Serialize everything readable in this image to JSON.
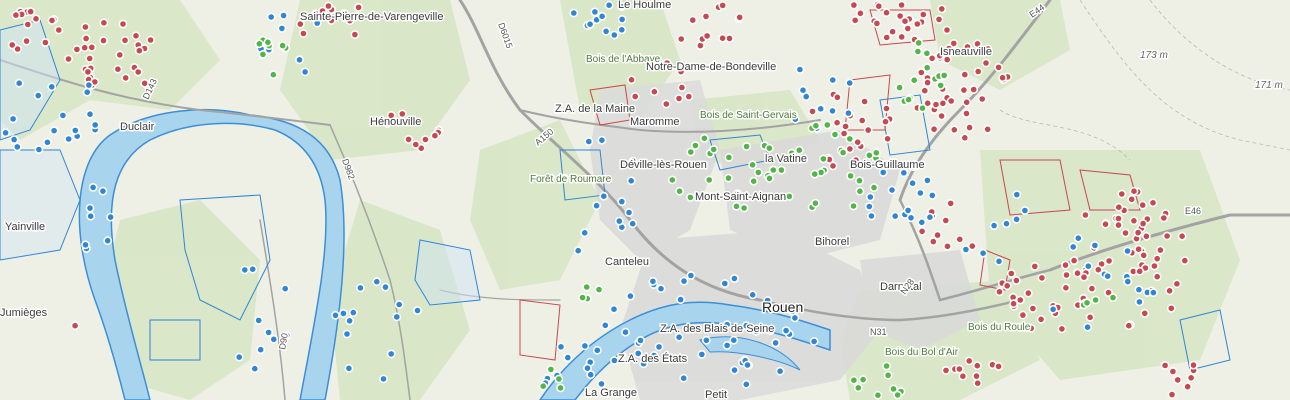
{
  "map": {
    "colors": {
      "background": "#eef0e6",
      "forest": "#d7e6c4",
      "urban": "#d9d9d9",
      "river": "#a9d4ee",
      "river_outline": "#3a8fd8",
      "road": "#9a9a9a",
      "red_marker": "#c9474f",
      "blue_marker": "#2f86d6",
      "green_marker": "#52b548"
    },
    "labels": {
      "sainte_pierre": "Sainte-Pierre-de-Varengeville",
      "le_houlme": "Le Houlme",
      "bois_abbaye": "Bois de l'Abbaye",
      "notre_dame": "Notre-Dame-de-Bondeville",
      "isneauville": "Isneauville",
      "duclair": "Duclair",
      "henouville": "Hénouville",
      "za_maine": "Z.A. de la Maine",
      "maromme": "Maromme",
      "bois_saint_gervais": "Bois de Saint-Gervais",
      "deville": "Déville-lès-Rouen",
      "foret_roumare": "Forêt de Roumare",
      "la_vatine": "la Vatine",
      "bois_guillaume": "Bois-Guillaume",
      "mont_saint_aignan": "Mont-Saint-Aignan",
      "yainville": "Yainville",
      "canteleu": "Canteleu",
      "darnetal": "Darnétal",
      "bihorel": "Bihorel",
      "rouen": "Rouen",
      "jumieges": "Jumièges",
      "za_blais": "Z.A. des Blais de Seine",
      "za_etats": "Z.A. des États",
      "bois_bol": "Bois du Bol d'Air",
      "bois_roule": "Bois du Roule",
      "petit": "Petit",
      "la_grange": "La Grange",
      "elev_173": "173 m",
      "elev_171": "171 m",
      "road_d6015": "D6015",
      "road_d143": "D143",
      "road_d982": "D982",
      "road_e46": "E46",
      "road_e44": "E44",
      "road_n28": "N28",
      "road_n31": "N31",
      "road_a150": "A150",
      "road_d90": "D90"
    }
  }
}
